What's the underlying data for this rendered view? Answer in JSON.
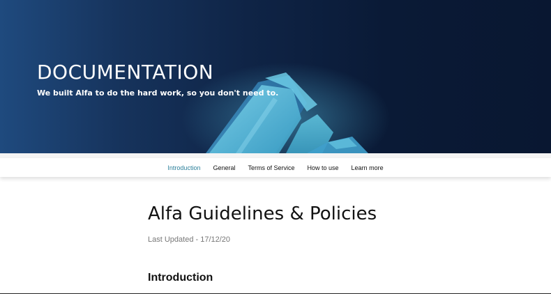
{
  "hero": {
    "title": "DOCUMENTATION",
    "tagline": "We built Alfa to do the hard work, so you don't need to."
  },
  "nav": {
    "items": [
      {
        "label": "Introduction",
        "active": true
      },
      {
        "label": "General",
        "active": false
      },
      {
        "label": "Terms of Service",
        "active": false
      },
      {
        "label": "How to use",
        "active": false
      },
      {
        "label": "Learn more",
        "active": false
      }
    ]
  },
  "content": {
    "title": "Alfa Guidelines & Policies",
    "last_updated": "Last Updated - 17/12/20",
    "section_heading": "Introduction"
  },
  "colors": {
    "hero_dark": "#0a1a36",
    "hero_light": "#1f4a7e",
    "nav_active": "#2a7f9a",
    "crystal": "#4fb6d6"
  }
}
